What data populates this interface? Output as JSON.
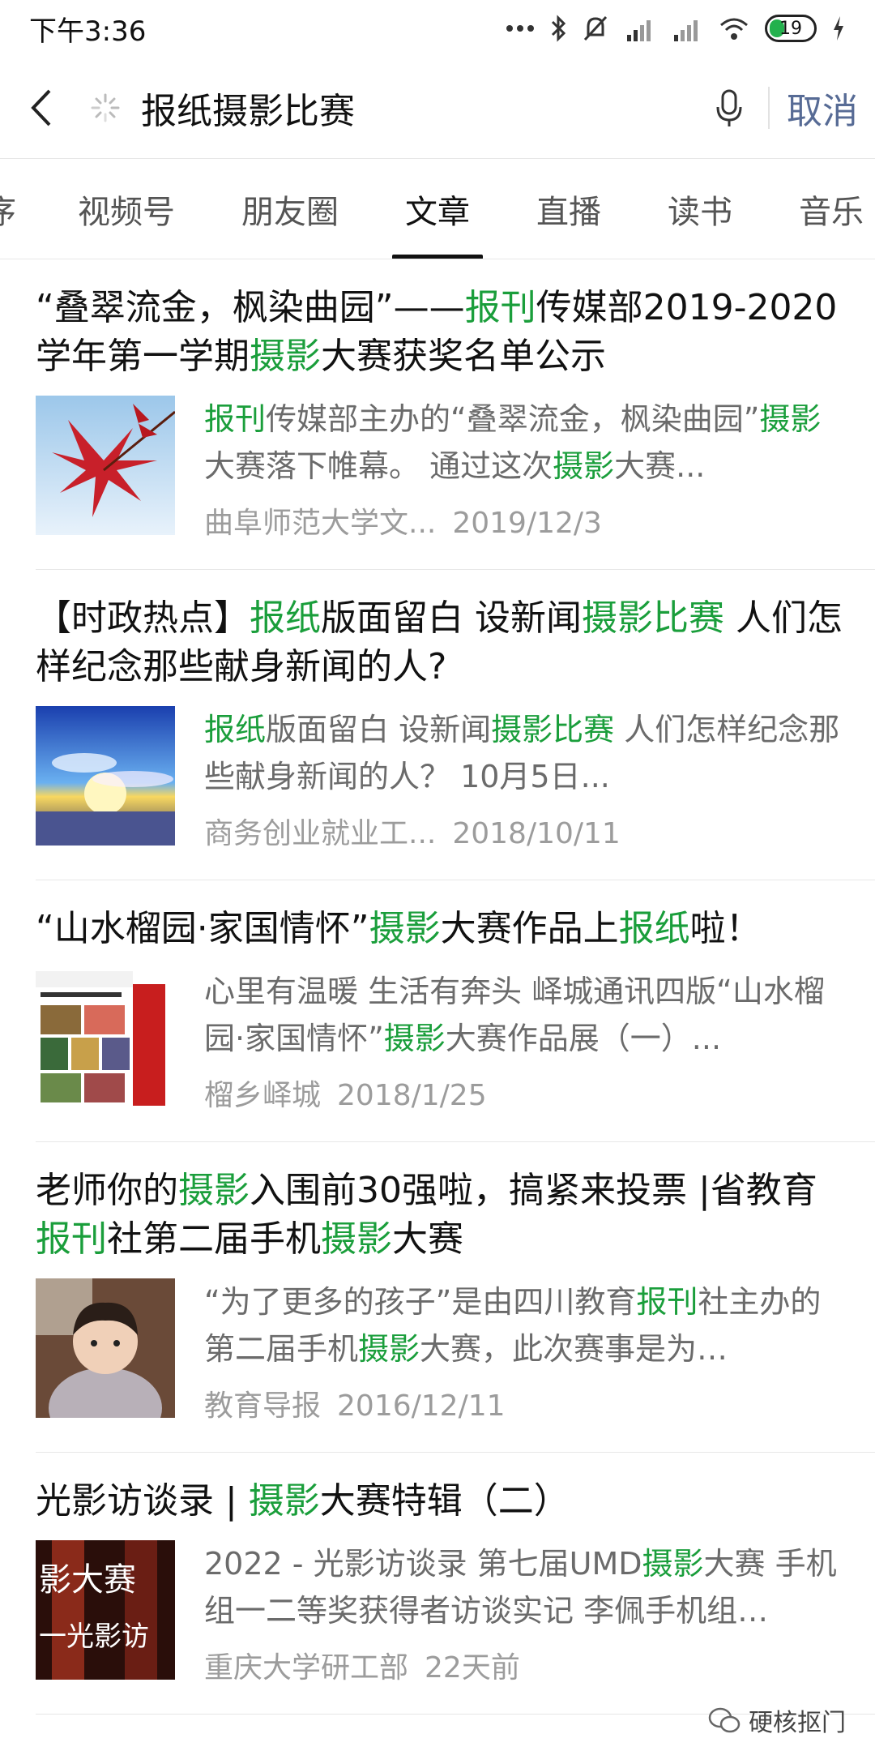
{
  "status": {
    "time": "下午3:36",
    "battery": "19"
  },
  "search": {
    "query": "报纸摄影比赛",
    "cancel": "取消"
  },
  "tabs": [
    "序",
    "视频号",
    "朋友圈",
    "文章",
    "直播",
    "读书",
    "音乐"
  ],
  "active_tab": "文章",
  "results": [
    {
      "title_parts": [
        [
          "“叠翠流金，枫染曲园”——",
          0
        ],
        [
          "报刊",
          1
        ],
        [
          "传媒部2019-2020学年第一学期",
          0
        ],
        [
          "摄影",
          1
        ],
        [
          "大赛获奖名单公示",
          0
        ]
      ],
      "desc_parts": [
        [
          "报刊",
          1
        ],
        [
          "传媒部主办的“叠翠流金，枫染曲园”",
          0
        ],
        [
          "摄影",
          1
        ],
        [
          "大赛落下帷幕。 通过这次",
          0
        ],
        [
          "摄影",
          1
        ],
        [
          "大赛...",
          0
        ]
      ],
      "source": "曲阜师范大学文...",
      "date": "2019/12/3",
      "thumb": "leaf-thumbnail"
    },
    {
      "title_parts": [
        [
          "【时政热点】",
          0
        ],
        [
          "报纸",
          1
        ],
        [
          "版面留白 设新闻",
          0
        ],
        [
          "摄影比赛",
          1
        ],
        [
          " 人们怎样纪念那些献身新闻的人?",
          0
        ]
      ],
      "desc_parts": [
        [
          "报纸",
          1
        ],
        [
          "版面留白 设新闻",
          0
        ],
        [
          "摄影比赛",
          1
        ],
        [
          " 人们怎样纪念那些献身新闻的人？ 10月5日...",
          0
        ]
      ],
      "source": "商务创业就业工...",
      "date": "2018/10/11",
      "thumb": "sunset-thumbnail"
    },
    {
      "title_parts": [
        [
          "“山水榴园·家国情怀”",
          0
        ],
        [
          "摄影",
          1
        ],
        [
          "大赛作品上",
          0
        ],
        [
          "报纸",
          1
        ],
        [
          "啦！",
          0
        ]
      ],
      "desc_parts": [
        [
          "心里有温暖 生活有奔头 峄城通讯四版“山水榴园·家国情怀”",
          0
        ],
        [
          "摄影",
          1
        ],
        [
          "大赛作品展（一）...",
          0
        ]
      ],
      "source": "榴乡峄城",
      "date": "2018/1/25",
      "thumb": "newspaper-thumbnail"
    },
    {
      "title_parts": [
        [
          "老师你的",
          0
        ],
        [
          "摄影",
          1
        ],
        [
          "入围前30强啦，搞紧来投票 |省教育",
          0
        ],
        [
          "报刊",
          1
        ],
        [
          "社第二届手机",
          0
        ],
        [
          "摄影",
          1
        ],
        [
          "大赛",
          0
        ]
      ],
      "desc_parts": [
        [
          "“为了更多的孩子”是由四川教育",
          0
        ],
        [
          "报刊",
          1
        ],
        [
          "社主办的第二届手机",
          0
        ],
        [
          "摄影",
          1
        ],
        [
          "大赛，此次赛事是为…",
          0
        ]
      ],
      "source": "教育导报",
      "date": "2016/12/11",
      "thumb": "child-thumbnail"
    },
    {
      "title_parts": [
        [
          "光影访谈录 | ",
          0
        ],
        [
          "摄影",
          1
        ],
        [
          "大赛特辑（二）",
          0
        ]
      ],
      "desc_parts": [
        [
          "2022 - 光影访谈录 第七届UMD",
          0
        ],
        [
          "摄影",
          1
        ],
        [
          "大赛 手机组一二等奖获得者访谈实记 李佩手机组…",
          0
        ]
      ],
      "source": "重庆大学研工部",
      "date": "22天前",
      "thumb": "banner-thumbnail"
    }
  ],
  "watermark": "硬核抠门",
  "colors": {
    "highlight": "#1a9e3b",
    "cancel": "#576b95"
  }
}
